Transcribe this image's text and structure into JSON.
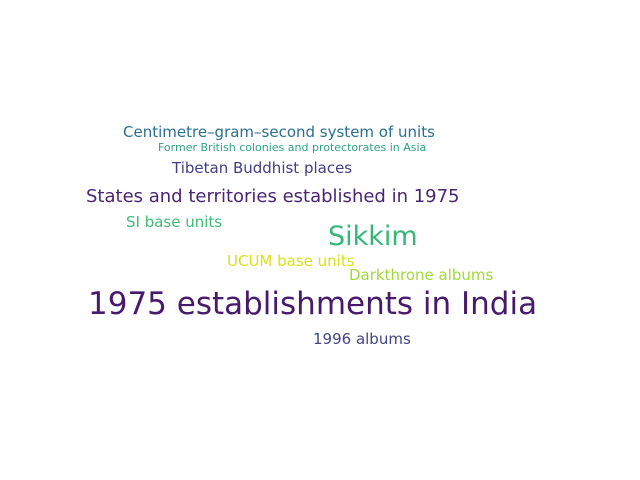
{
  "words": [
    {
      "text": "Centimetre–gram–second system of units",
      "color": "#2a6f8f"
    },
    {
      "text": "Former British colonies and protectorates in Asia",
      "color": "#2ea37e"
    },
    {
      "text": "Tibetan Buddhist places",
      "color": "#433e85"
    },
    {
      "text": "States and territories established in 1975",
      "color": "#4b2474"
    },
    {
      "text": "SI base units",
      "color": "#3fbc73"
    },
    {
      "text": "Sikkim",
      "color": "#35b779"
    },
    {
      "text": "UCUM base units",
      "color": "#d8e219"
    },
    {
      "text": "Darkthrone albums",
      "color": "#a0da39"
    },
    {
      "text": "1975 establishments in India",
      "color": "#481a6c"
    },
    {
      "text": "1996 albums",
      "color": "#414487"
    }
  ]
}
